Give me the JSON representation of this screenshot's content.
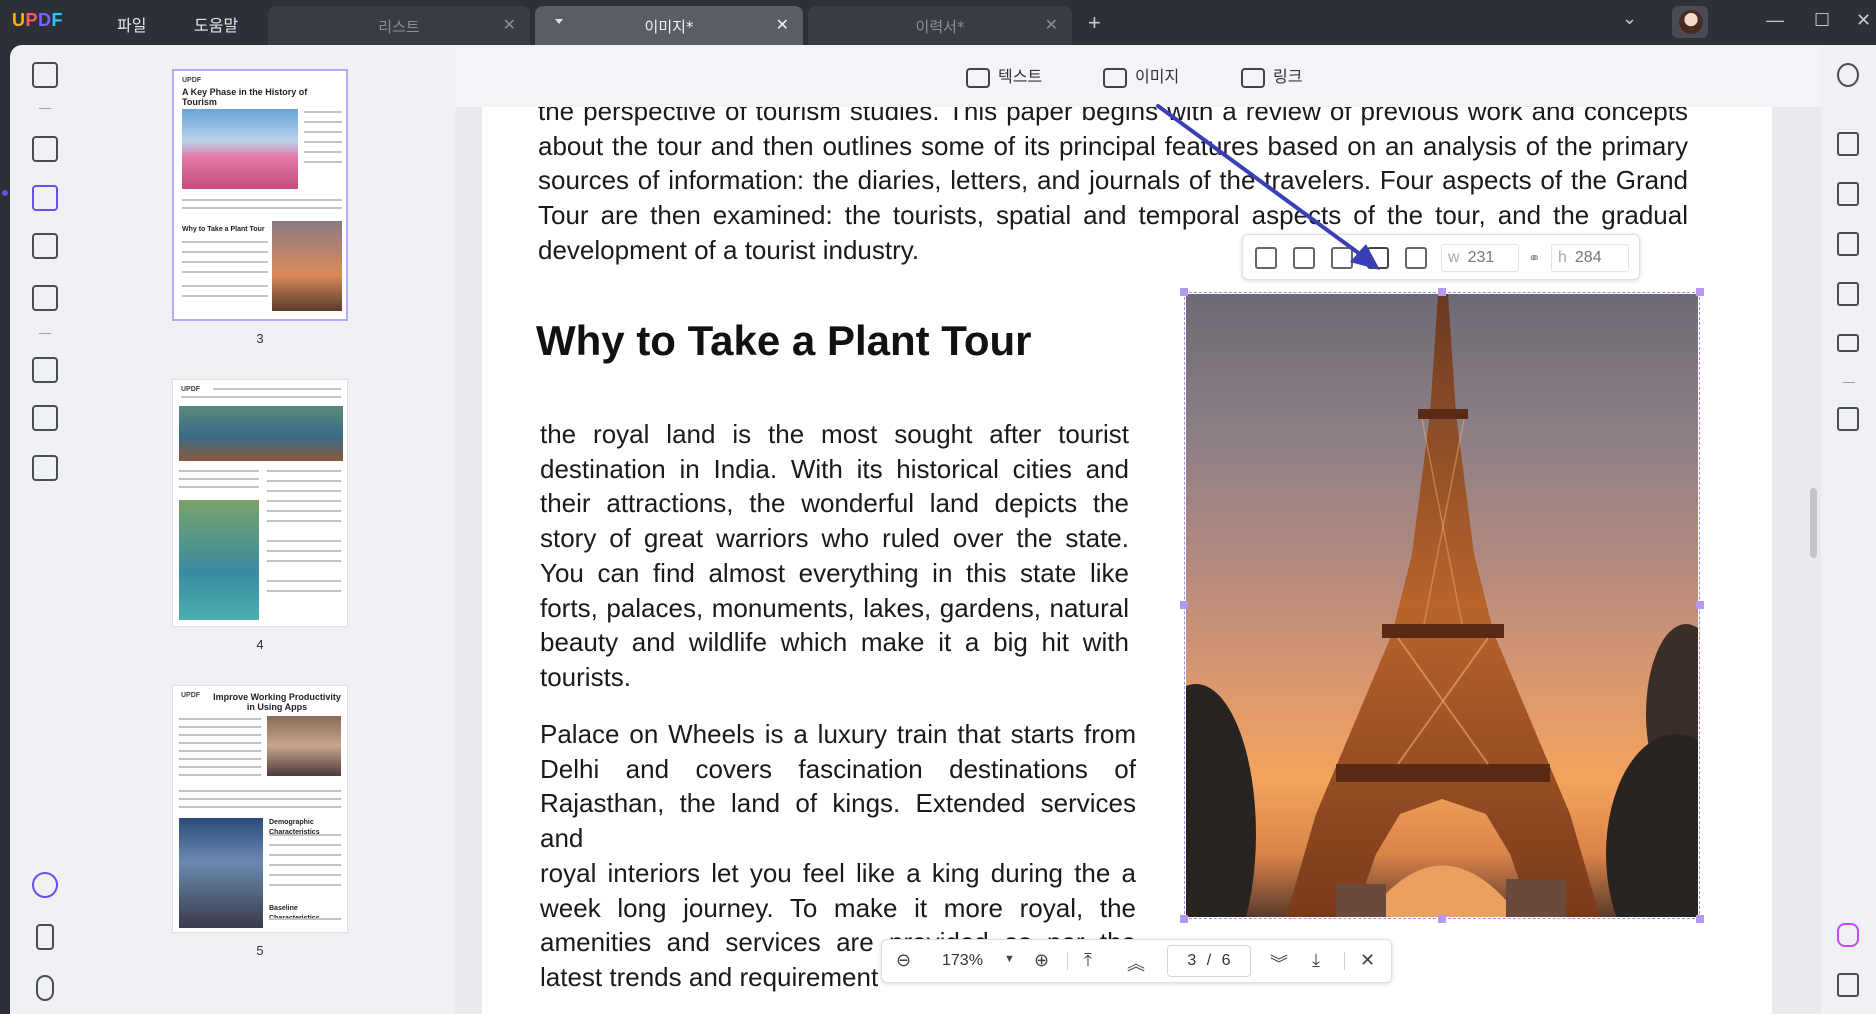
{
  "app": {
    "logo_letters": [
      "U",
      "P",
      "D",
      "F"
    ],
    "menu": [
      "파일",
      "도움말"
    ],
    "tabs": [
      {
        "label": "리스트",
        "active": false
      },
      {
        "label": "이미지*",
        "active": true
      },
      {
        "label": "이력서*",
        "active": false
      }
    ],
    "new_tab": "+",
    "window_controls": {
      "dropdown": "⌄",
      "minimize": "—",
      "maximize": "☐",
      "close": "✕"
    }
  },
  "edit_toolbar": {
    "text": "텍스트",
    "image": "이미지",
    "link": "링크"
  },
  "thumbnails": [
    {
      "page": "3",
      "title": "A Key Phase in the History of Tourism",
      "sub": "Why to Take a Plant Tour",
      "brand": "UPDF",
      "selected": true
    },
    {
      "page": "4",
      "brand": "UPDF",
      "selected": false
    },
    {
      "page": "5",
      "title": "Improve Working Productivity in Using Apps",
      "sub": "Demographic Characteristics",
      "sub2": "Baseline Characteristics",
      "brand": "UPDF",
      "selected": false
    }
  ],
  "document": {
    "top_paragraph": [
      "the perspective of tourism studies. This paper begins with a review of previous work and concepts",
      "about the tour and then outlines some of its principal features based on an analysis of the primary",
      "sources of information: the diaries, letters, and journals of the travelers. Four aspects of the Grand",
      "Tour are then examined: the tourists, spatial and temporal aspects of the tour, and the gradual",
      "development of a tourist industry."
    ],
    "heading": "Why to Take a Plant Tour",
    "para1": [
      "the royal land is the most sought after tourist",
      "destination in India. With its historical cities and",
      "their attractions, the wonderful land depicts the",
      "story of great warriors who ruled over the state.",
      "You can find almost everything in this state like",
      "forts, palaces, monuments, lakes, gardens, natural",
      "beauty and wildlife which make it a big hit with",
      "tourists."
    ],
    "para2": [
      "Palace on Wheels is a luxury train that starts from",
      "Delhi and covers fascination destinations of",
      "Rajasthan, the land of kings. Extended services and",
      "royal interiors let you feel like a king during the a",
      "week long journey. To make it more royal, the",
      "amenities and services are provided as per the",
      "latest trends and requirement"
    ]
  },
  "image_toolbar": {
    "width_label": "w",
    "width_value": "231",
    "height_label": "h",
    "height_value": "284"
  },
  "page_bar": {
    "zoom": "173%",
    "current_page": "3",
    "separator": "/",
    "total_pages": "6"
  },
  "colors": {
    "accent": "#6c4df5",
    "titlebar": "#2e3038",
    "panel": "#f0f1f4",
    "selection": "#a58bea",
    "annotation_arrow": "#3a3fb5"
  }
}
